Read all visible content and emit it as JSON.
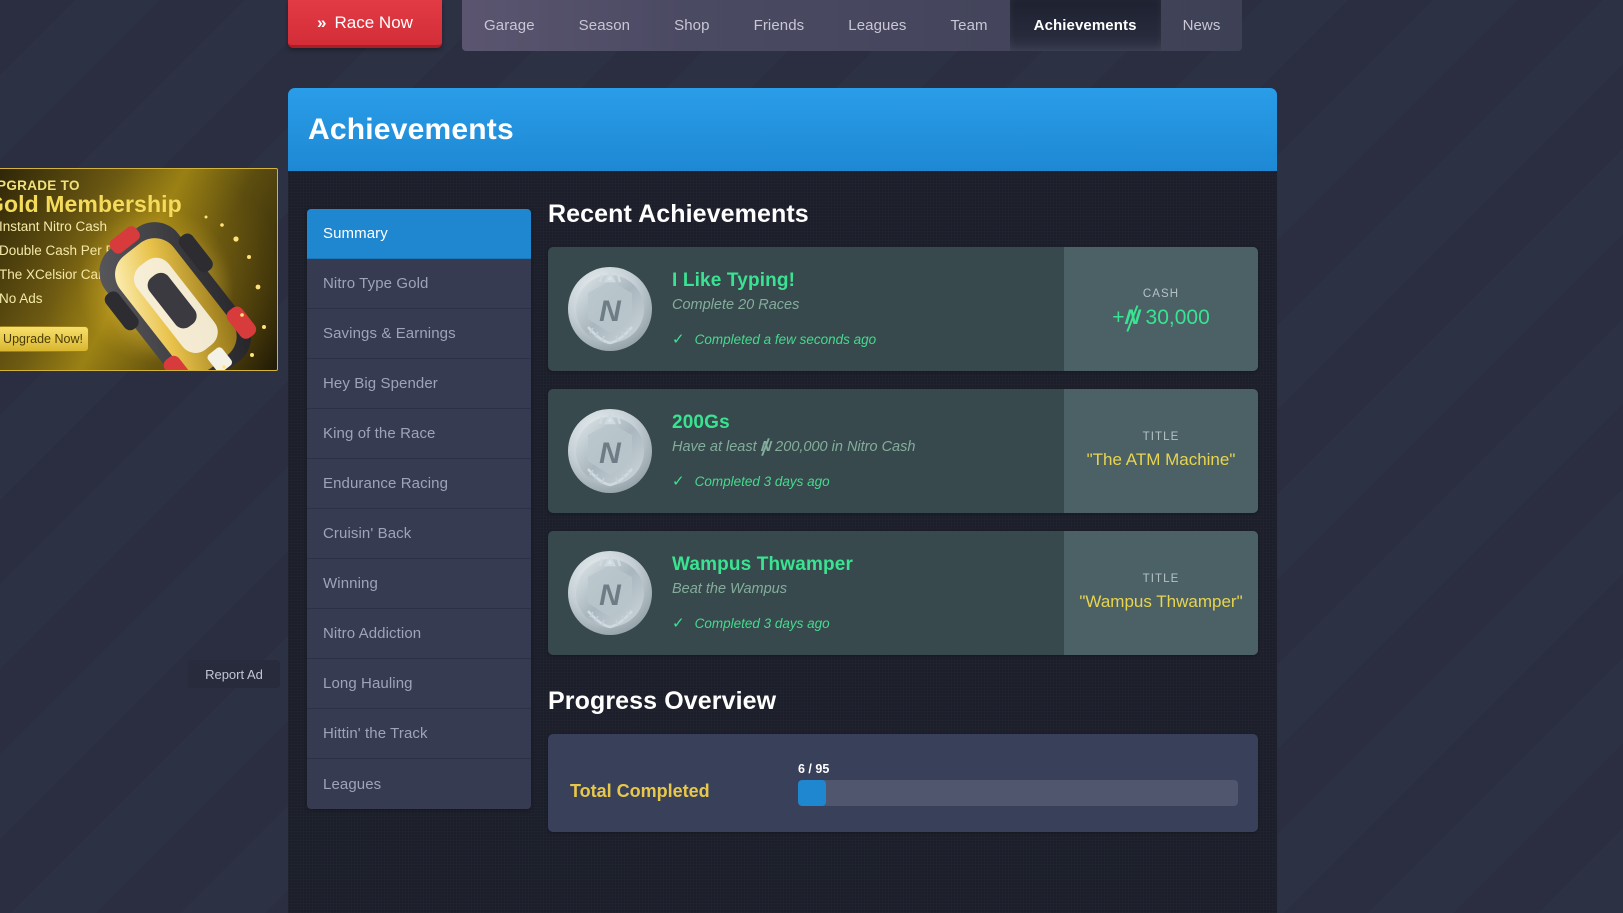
{
  "topnav": {
    "race_now": {
      "label": "Race Now",
      "icon": "double-chevron-right-icon",
      "color": "#d32d38"
    },
    "tabs": [
      {
        "label": "Garage",
        "active": false
      },
      {
        "label": "Season",
        "active": false
      },
      {
        "label": "Shop",
        "active": false
      },
      {
        "label": "Friends",
        "active": false
      },
      {
        "label": "Leagues",
        "active": false
      },
      {
        "label": "Team",
        "active": false
      },
      {
        "label": "Achievements",
        "active": true
      },
      {
        "label": "News",
        "active": false
      }
    ]
  },
  "header": {
    "title": "Achievements",
    "accent": "#1e88d4"
  },
  "sidebar": {
    "items": [
      {
        "label": "Summary",
        "active": true
      },
      {
        "label": "Nitro Type Gold",
        "active": false
      },
      {
        "label": "Savings & Earnings",
        "active": false
      },
      {
        "label": "Hey Big Spender",
        "active": false
      },
      {
        "label": "King of the Race",
        "active": false
      },
      {
        "label": "Endurance Racing",
        "active": false
      },
      {
        "label": "Cruisin' Back",
        "active": false
      },
      {
        "label": "Winning",
        "active": false
      },
      {
        "label": "Nitro Addiction",
        "active": false
      },
      {
        "label": "Long Hauling",
        "active": false
      },
      {
        "label": "Hittin' the Track",
        "active": false
      },
      {
        "label": "Leagues",
        "active": false
      }
    ]
  },
  "main": {
    "recent_title": "Recent Achievements",
    "medal_icon": "silver-medal-icon",
    "medal_motto": "PERFECTUS USUS FACIT",
    "achievements": [
      {
        "name": "I Like Typing!",
        "description": "Complete 20 Races",
        "description_prefix": "Complete 20 Races",
        "description_suffix": "",
        "has_currency_in_desc": false,
        "status_check": "✓",
        "status": "Completed a few seconds ago",
        "reward_label": "CASH",
        "reward_kind": "cash",
        "reward_value": "+₦ 30,000",
        "reward_cash_prefix": "+",
        "reward_cash_amount": "30,000"
      },
      {
        "name": "200Gs",
        "description": "Have at least ₦ 200,000 in Nitro Cash",
        "description_prefix": "Have at least ",
        "description_suffix": " 200,000 in Nitro Cash",
        "has_currency_in_desc": true,
        "status_check": "✓",
        "status": "Completed 3 days ago",
        "reward_label": "TITLE",
        "reward_kind": "title",
        "reward_value": "\"The ATM Machine\""
      },
      {
        "name": "Wampus Thwamper",
        "description": "Beat the Wampus",
        "description_prefix": "Beat the Wampus",
        "description_suffix": "",
        "has_currency_in_desc": false,
        "status_check": "✓",
        "status": "Completed 3 days ago",
        "reward_label": "TITLE",
        "reward_kind": "title",
        "reward_value": "\"Wampus Thwamper\""
      }
    ],
    "progress_title": "Progress Overview",
    "progress": {
      "label": "Total Completed",
      "count_text": "6 / 95",
      "completed": 6,
      "total": 95,
      "percent": 6.3,
      "bar_color": "#1e87d0"
    }
  },
  "ad": {
    "upgrade_to": "UPGRADE TO",
    "headline": "Gold Membership",
    "benefits": [
      "Instant Nitro Cash",
      "Double Cash Per Race",
      "The XCelsior Car",
      "No Ads"
    ],
    "cta": "Upgrade Now!",
    "car_icon": "gold-race-car-icon",
    "report": "Report Ad"
  },
  "colors": {
    "page_bg": "#2b2f42",
    "panel_bg": "#1c1f2b",
    "header_blue": "#1e88d4",
    "card_bg": "#37494c",
    "card_reward_bg": "#4c6166",
    "green": "#3ae391",
    "gold": "#e8c84a",
    "sidebar_item": "#373b52"
  }
}
